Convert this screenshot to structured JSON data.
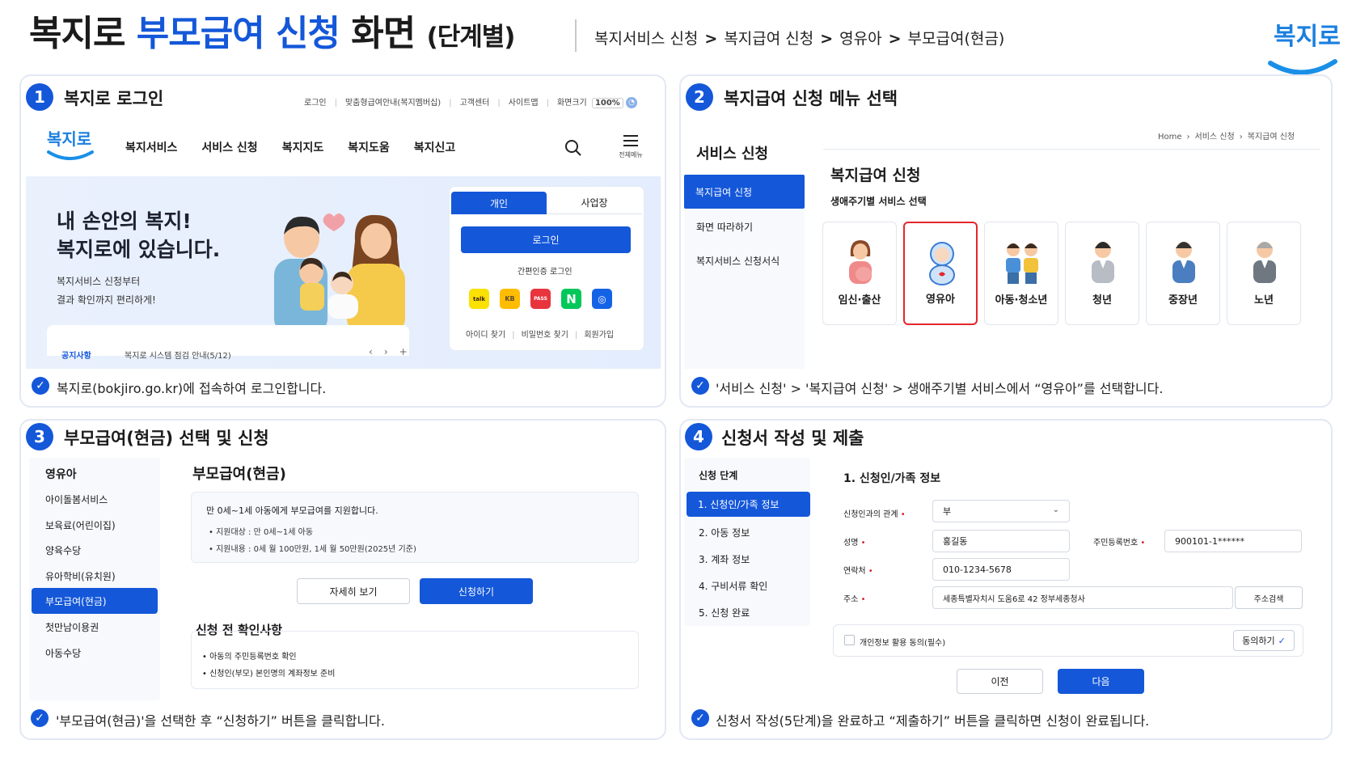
{
  "header": {
    "title_a": "복지로 ",
    "title_b": "부모급여 신청",
    "title_c": " 화면",
    "title_sub": "(단계별)",
    "breadcrumb": [
      "복지서비스 신청",
      "복지급여 신청",
      "영유아",
      "부모급여(현금)"
    ],
    "logo_text": "복지로"
  },
  "step1": {
    "num": "1",
    "title": "복지로 로그인",
    "topbar": [
      "로그인",
      "맞춤형급여안내(복지멤버십)",
      "고객센터",
      "사이트맵",
      "화면크기"
    ],
    "zoom": "100%",
    "logo": "복지로",
    "nav": [
      "복지서비스",
      "서비스 신청",
      "복지지도",
      "복지도움",
      "복지신고"
    ],
    "menu_label": "전체메뉴",
    "hero_line1": "내 손안의 복지!",
    "hero_line2": "복지로에 있습니다.",
    "hero_sub1": "복지서비스 신청부터",
    "hero_sub2": "결과 확인까지 편리하게!",
    "notice_label": "공지사항",
    "notice_text": "복지로 시스템 점검 안내(5/12)",
    "tab_personal": "개인",
    "tab_business": "사업장",
    "login_btn": "로그인",
    "easy_login": "간편인증 로그인",
    "easy_icons": [
      {
        "name": "kakao",
        "label": "카카오",
        "color": "#fae100",
        "fg": "#3a1d1d"
      },
      {
        "name": "kb",
        "label": "KB",
        "color": "#ffbc00",
        "fg": "#5b4a33"
      },
      {
        "name": "pass",
        "label": "PASS",
        "color": "#e8343d",
        "fg": "#ffffff"
      },
      {
        "name": "naver",
        "label": "N",
        "color": "#03c75a",
        "fg": "#ffffff"
      },
      {
        "name": "other",
        "label": "◎",
        "color": "#1463e6",
        "fg": "#ffffff"
      }
    ],
    "links": [
      "아이디 찾기",
      "비밀번호 찾기",
      "회원가입"
    ],
    "caption": "복지로(bokjiro.go.kr)에 접속하여 로그인합니다."
  },
  "step2": {
    "num": "2",
    "title": "복지급여 신청 메뉴 선택",
    "side_title": "서비스 신청",
    "side_items": [
      "복지급여 신청",
      "화면 따라하기",
      "복지서비스 신청서식"
    ],
    "breadcrumb": [
      "Home",
      "서비스 신청",
      "복지급여 신청"
    ],
    "heading": "복지급여 신청",
    "subheading": "생애주기별 서비스 선택",
    "cards": [
      "임신·출산",
      "영유아",
      "아동·청소년",
      "청년",
      "중장년",
      "노년"
    ],
    "selected": "영유아",
    "caption": "'서비스 신청' > '복지급여 신청' > 생애주기별 서비스에서 “영유아”를 선택합니다."
  },
  "step3": {
    "num": "3",
    "title": "부모급여(현금) 선택 및 신청",
    "side_title": "영유아",
    "side_items": [
      "아이돌봄서비스",
      "보육료(어린이집)",
      "양육수당",
      "유아학비(유치원)",
      "부모급여(현금)",
      "첫만남이용권",
      "아동수당"
    ],
    "side_selected": "부모급여(현금)",
    "heading": "부모급여(현금)",
    "info_main": "만 0세~1세 아동에게 부모급여를 지원합니다.",
    "info_items": [
      "지원대상 : 만 0세~1세 아동",
      "지원내용 : 0세 월 100만원, 1세 월 50만원(2025년 기준)"
    ],
    "btn_detail": "자세히 보기",
    "btn_apply": "신청하기",
    "check_title": "신청 전 확인사항",
    "check_items": [
      "아동의 주민등록번호 확인",
      "신청인(부모) 본인명의 계좌정보 준비"
    ],
    "caption": "'부모급여(현금)'을 선택한 후 “신청하기” 버튼을 클릭합니다."
  },
  "step4": {
    "num": "4",
    "title": "신청서 작성 및 제출",
    "side_title": "신청 단계",
    "steps": [
      "1. 신청인/가족 정보",
      "2. 아동 정보",
      "3. 계좌 정보",
      "4. 구비서류 확인",
      "5. 신청 완료"
    ],
    "heading": "1. 신청인/가족 정보",
    "relation_label": "신청인과의 관계",
    "relation_value": "부",
    "name_label": "성명",
    "name_value": "홍길동",
    "rrn_label": "주민등록번호",
    "rrn_value": "900101-1******",
    "phone_label": "연락처",
    "phone_value": "010-1234-5678",
    "addr_label": "주소",
    "addr_value": "세종특별자치시 도움6로 42 정부세종청사",
    "addr_btn": "주소검색",
    "agree_text": "개인정보 활용 동의(필수)",
    "agree_btn": "동의하기",
    "btn_prev": "이전",
    "btn_next": "다음",
    "caption": "신청서 작성(5단계)을 완료하고 “제출하기” 버튼을 클릭하면 신청이 완료됩니다."
  },
  "colors": {
    "accent": "#1457d9",
    "selected_border": "#e5262b",
    "panel_border": "#e2e8f3",
    "hero_bg": "#eaf1fd"
  }
}
